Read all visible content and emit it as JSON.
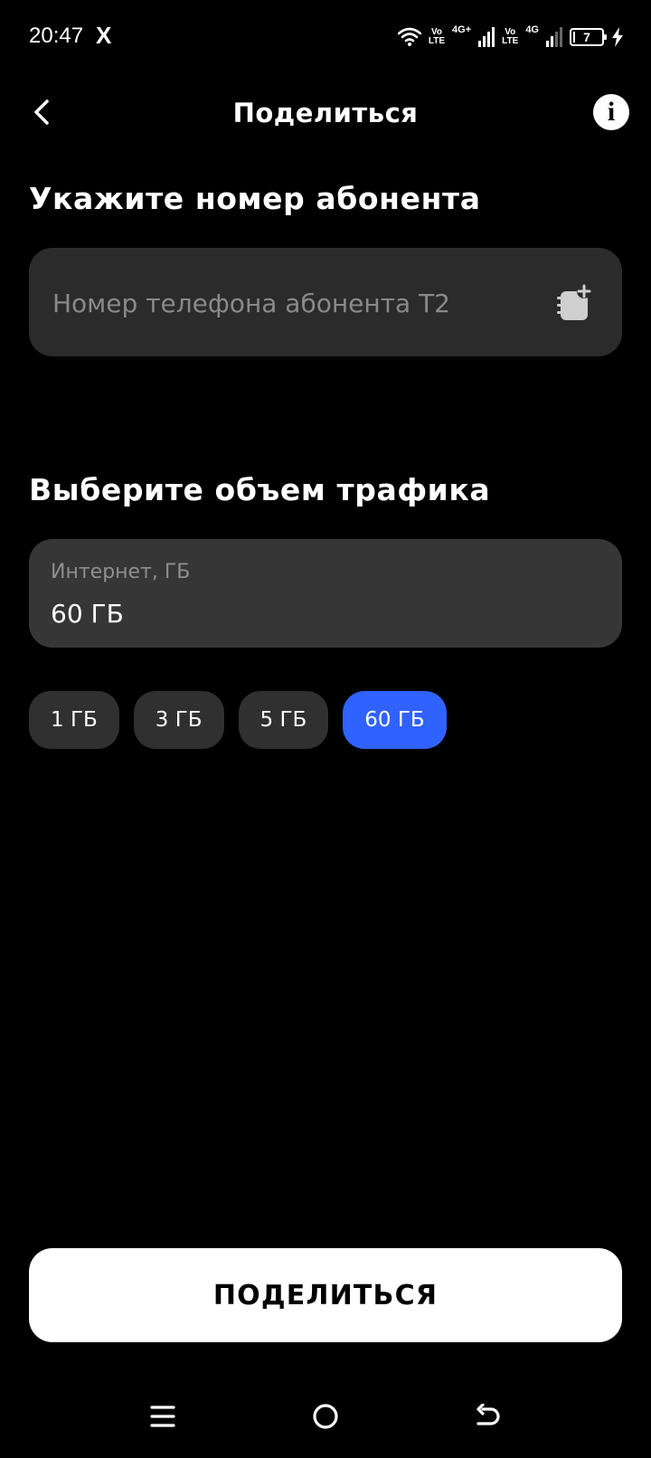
{
  "status_bar": {
    "time": "20:47",
    "app_notification": "X",
    "volte_1": "Vo\nLTE",
    "net_1": "4G+",
    "volte_2": "Vo\nLTE",
    "net_2": "4G",
    "battery_level": "7",
    "battery_fraction": 0.07
  },
  "header": {
    "title": "Поделиться",
    "back_icon": "chevron-left-icon",
    "info_icon": "info-icon"
  },
  "subscriber_section": {
    "heading": "Укажите номер абонента",
    "phone_value": "",
    "phone_placeholder": "Номер телефона абонента Т2",
    "contact_icon": "add-contact-icon"
  },
  "traffic_section": {
    "heading": "Выберите объем трафика",
    "field_label": "Интернет, ГБ",
    "field_value": "60 ГБ",
    "options": [
      {
        "label": "1 ГБ",
        "selected": false
      },
      {
        "label": "3 ГБ",
        "selected": false
      },
      {
        "label": "5 ГБ",
        "selected": false
      },
      {
        "label": "60 ГБ",
        "selected": true
      }
    ]
  },
  "share_button": {
    "label": "ПОДЕЛИТЬСЯ"
  },
  "colors": {
    "accent": "#2f62ff",
    "background": "#000000",
    "field_bg": "#2b2b2b",
    "chip_bg": "#303030"
  },
  "nav_bar": {
    "menu_icon": "menu-icon",
    "home_icon": "home-icon",
    "back_icon": "back-arrow-icon"
  }
}
